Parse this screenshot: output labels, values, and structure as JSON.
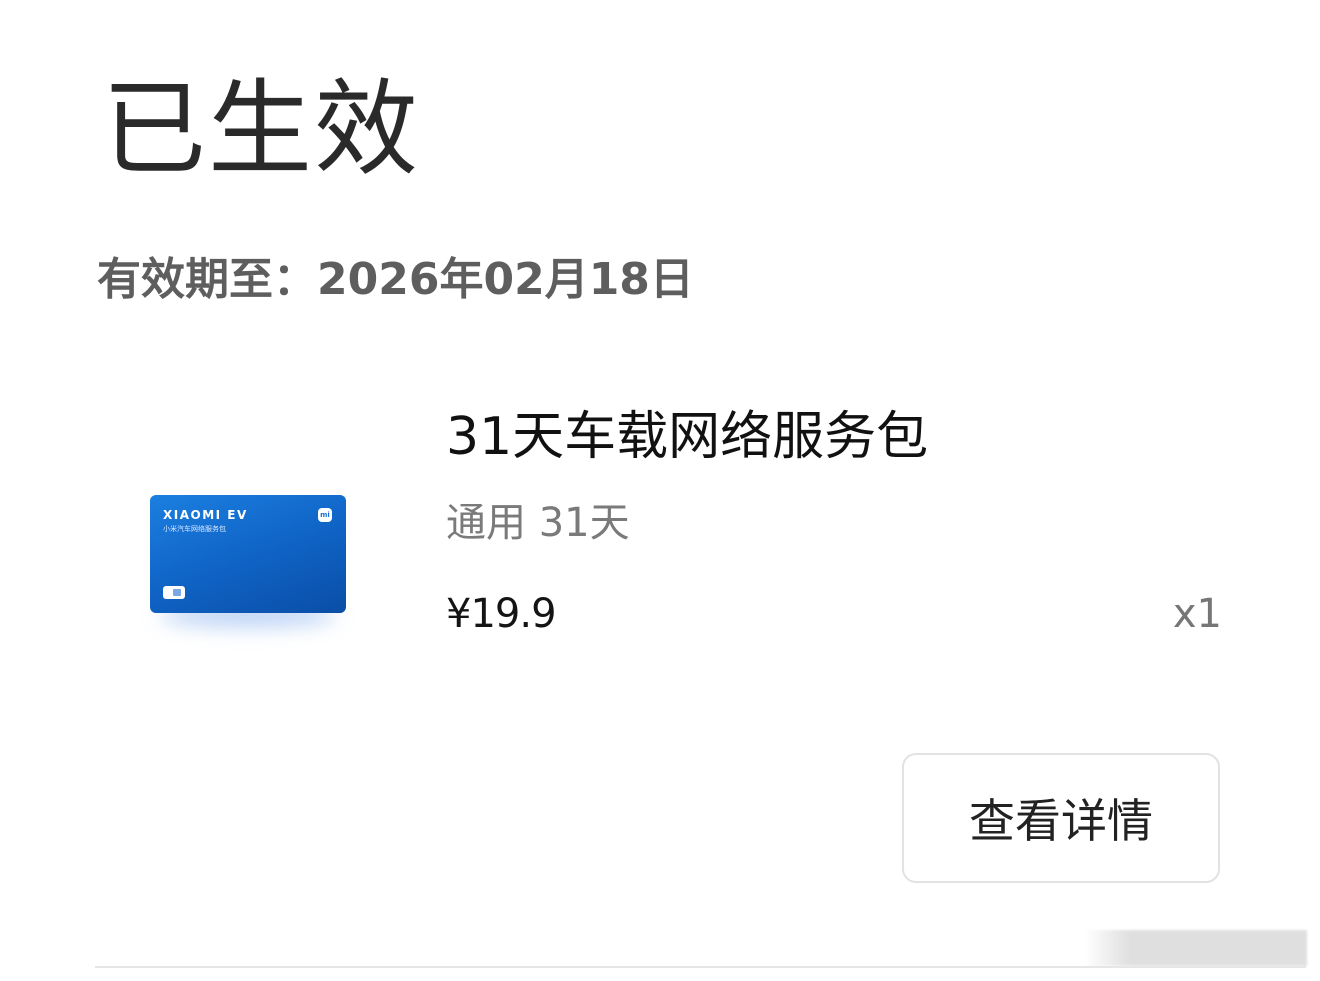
{
  "status": {
    "title": "已生效",
    "validity": "有效期至：2026年02月18日"
  },
  "card": {
    "brand": "XIAOMI EV",
    "subtitle": "小米汽车网络服务包",
    "logo": "mi",
    "accent_color": "#1670d8"
  },
  "product": {
    "name": "31天车载网络服务包",
    "spec": "通用 31天",
    "price": "¥19.9",
    "quantity": "x1"
  },
  "actions": {
    "detail_label": "查看详情"
  }
}
